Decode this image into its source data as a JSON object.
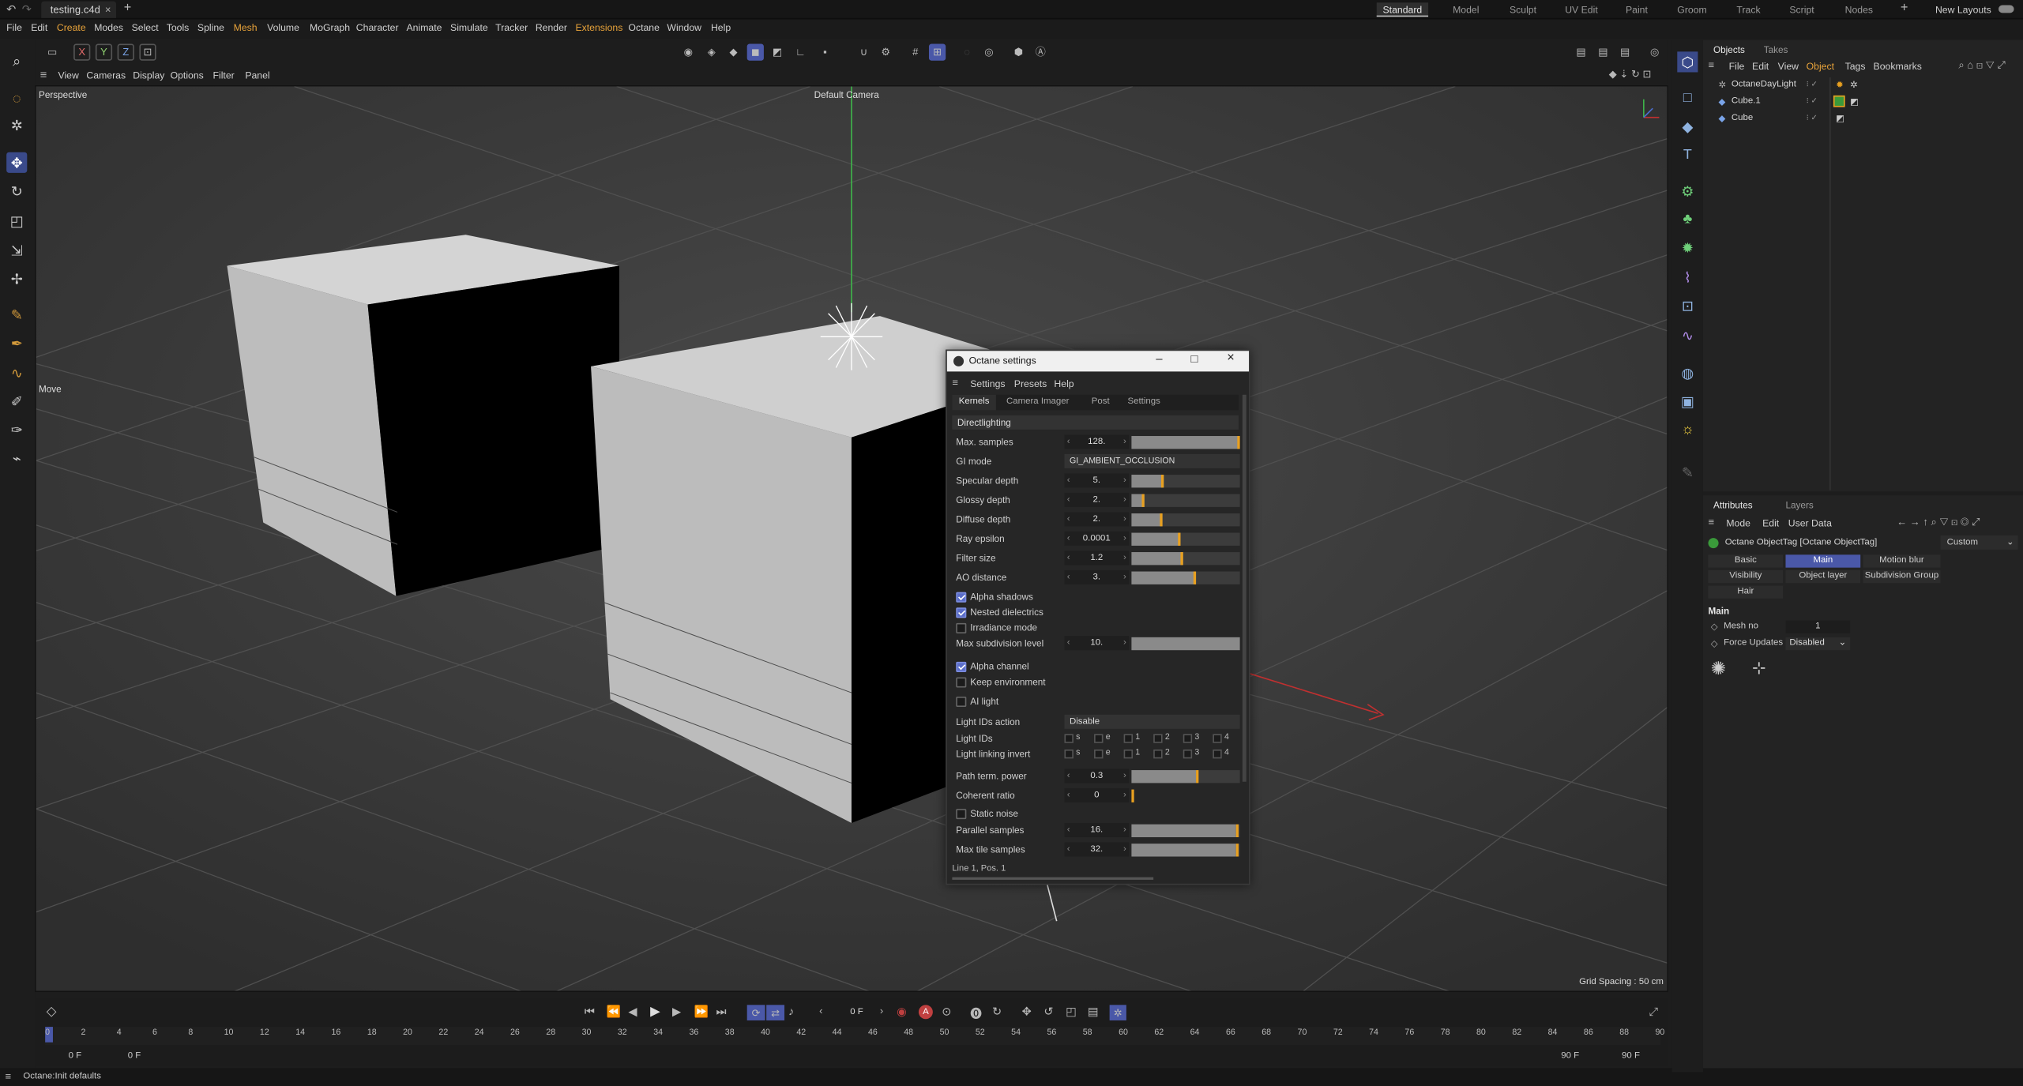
{
  "window": {
    "tab_title": "testing.c4d",
    "layouts": [
      "Standard",
      "Model",
      "Sculpt",
      "UV Edit",
      "Paint",
      "Groom",
      "Track",
      "Script",
      "Nodes"
    ],
    "new_layouts_label": "New Layouts"
  },
  "menu": [
    "File",
    "Edit",
    "Create",
    "Modes",
    "Select",
    "Tools",
    "Spline",
    "Mesh",
    "Volume",
    "MoGraph",
    "Character",
    "Animate",
    "Simulate",
    "Tracker",
    "Render",
    "Extensions",
    "Octane",
    "Window",
    "Help"
  ],
  "toolbar": {
    "axis_x": "X",
    "axis_y": "Y",
    "axis_z": "Z"
  },
  "viewport": {
    "menus": [
      "View",
      "Cameras",
      "Display",
      "Options",
      "Filter",
      "Panel"
    ],
    "projection": "Perspective",
    "camera": "Default Camera",
    "tool_label": "Move",
    "grid_spacing": "Grid Spacing : 50 cm"
  },
  "timeline": {
    "current_frame": "0 F",
    "ticks": [
      "0",
      "2",
      "4",
      "6",
      "8",
      "10",
      "12",
      "14",
      "16",
      "18",
      "20",
      "22",
      "24",
      "26",
      "28",
      "30",
      "32",
      "34",
      "36",
      "38",
      "40",
      "42",
      "44",
      "46",
      "48",
      "50",
      "52",
      "54",
      "56",
      "58",
      "60",
      "62",
      "64",
      "66",
      "68",
      "70",
      "72",
      "74",
      "76",
      "78",
      "80",
      "82",
      "84",
      "86",
      "88",
      "90"
    ],
    "start_field": "0 F",
    "start_field2": "0 F",
    "end_field": "90 F",
    "end_field2": "90 F"
  },
  "status": {
    "text": "Octane:Init defaults"
  },
  "objects_panel": {
    "tabs": [
      "Objects",
      "Takes"
    ],
    "menus": [
      "File",
      "Edit",
      "View",
      "Object",
      "Tags",
      "Bookmarks"
    ],
    "items": [
      {
        "name": "OctaneDayLight"
      },
      {
        "name": "Cube.1"
      },
      {
        "name": "Cube"
      }
    ]
  },
  "attributes_panel": {
    "tabs": [
      "Attributes",
      "Layers"
    ],
    "menus": [
      "Mode",
      "Edit",
      "User Data"
    ],
    "tag_title": "Octane ObjectTag [Octane ObjectTag]",
    "preset": "Custom",
    "buttons": [
      "Basic",
      "Main",
      "Motion blur",
      "Visibility",
      "Object layer",
      "Subdivision Group",
      "Hair"
    ],
    "section": "Main",
    "mesh_no_label": "Mesh no",
    "mesh_no_value": "1",
    "force_updates_label": "Force Updates",
    "force_updates_value": "Disabled"
  },
  "octane_dialog": {
    "title": "Octane settings",
    "menus": [
      "Settings",
      "Presets",
      "Help"
    ],
    "tabs": [
      "Kernels",
      "Camera Imager",
      "Post",
      "Settings"
    ],
    "kernel": "Directlighting",
    "gi_mode_label": "GI mode",
    "gi_mode_value": "GI_AMBIENT_OCCLUSION",
    "params": [
      {
        "label": "Max. samples",
        "value": "128.",
        "fill": 1.0
      },
      {
        "label": "Specular depth",
        "value": "5.",
        "fill": 0.3
      },
      {
        "label": "Glossy depth",
        "value": "2.",
        "fill": 0.12
      },
      {
        "label": "Diffuse depth",
        "value": "2.",
        "fill": 0.28
      },
      {
        "label": "Ray epsilon",
        "value": "0.0001",
        "fill": 0.45
      },
      {
        "label": "Filter size",
        "value": "1.2",
        "fill": 0.48
      },
      {
        "label": "AO distance",
        "value": "3.",
        "fill": 0.6
      }
    ],
    "checks1": [
      {
        "label": "Alpha shadows",
        "checked": true
      },
      {
        "label": "Nested dielectrics",
        "checked": true
      },
      {
        "label": "Irradiance mode",
        "checked": false
      }
    ],
    "max_subdiv_label": "Max subdivision level",
    "max_subdiv_value": "10.",
    "checks2": [
      {
        "label": "Alpha channel",
        "checked": true
      },
      {
        "label": "Keep environment",
        "checked": false
      }
    ],
    "ai_light_label": "AI light",
    "light_ids_action_label": "Light IDs action",
    "light_ids_action_value": "Disable",
    "light_ids_label": "Light IDs",
    "light_linking_label": "Light linking invert",
    "id_letters": [
      "s",
      "e",
      "1",
      "2",
      "3",
      "4"
    ],
    "path_term_label": "Path term. power",
    "path_term_value": "0.3",
    "coherent_label": "Coherent ratio",
    "coherent_value": "0",
    "static_noise_label": "Static noise",
    "parallel_label": "Parallel samples",
    "parallel_value": "16.",
    "max_tile_label": "Max tile samples",
    "max_tile_value": "32.",
    "status": "Line 1, Pos. 1"
  }
}
